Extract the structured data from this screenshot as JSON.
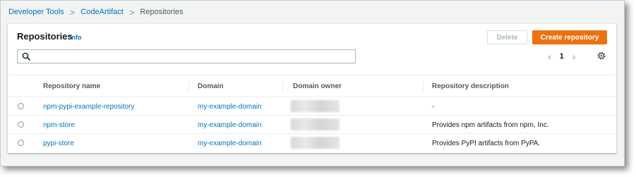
{
  "breadcrumb": {
    "items": [
      "Developer Tools",
      "CodeArtifact"
    ],
    "current": "Repositories",
    "separator": ">"
  },
  "panel": {
    "title": "Repositories",
    "info_label": "Info",
    "delete_label": "Delete",
    "create_label": "Create repository",
    "search_placeholder": "",
    "search_value": "",
    "page_number": "1",
    "prev_glyph": "‹",
    "next_glyph": "›"
  },
  "table": {
    "headers": [
      "Repository name",
      "Domain",
      "Domain owner",
      "Repository description"
    ],
    "rows": [
      {
        "name": "npm-pypi-example-repository",
        "domain": "my-example-domain",
        "owner": "",
        "description": "-"
      },
      {
        "name": "npm-store",
        "domain": "my-example-domain",
        "owner": "",
        "description": "Provides npm artifacts from npm, Inc."
      },
      {
        "name": "pypi-store",
        "domain": "my-example-domain",
        "owner": "",
        "description": "Provides PyPI artifacts from PyPA."
      }
    ]
  },
  "colors": {
    "link": "#0073bb",
    "primary_button": "#ec7211",
    "background": "#f2f3f3"
  },
  "icons": {
    "search": "search-icon",
    "settings": "gear-icon",
    "radio": "radio-button"
  }
}
